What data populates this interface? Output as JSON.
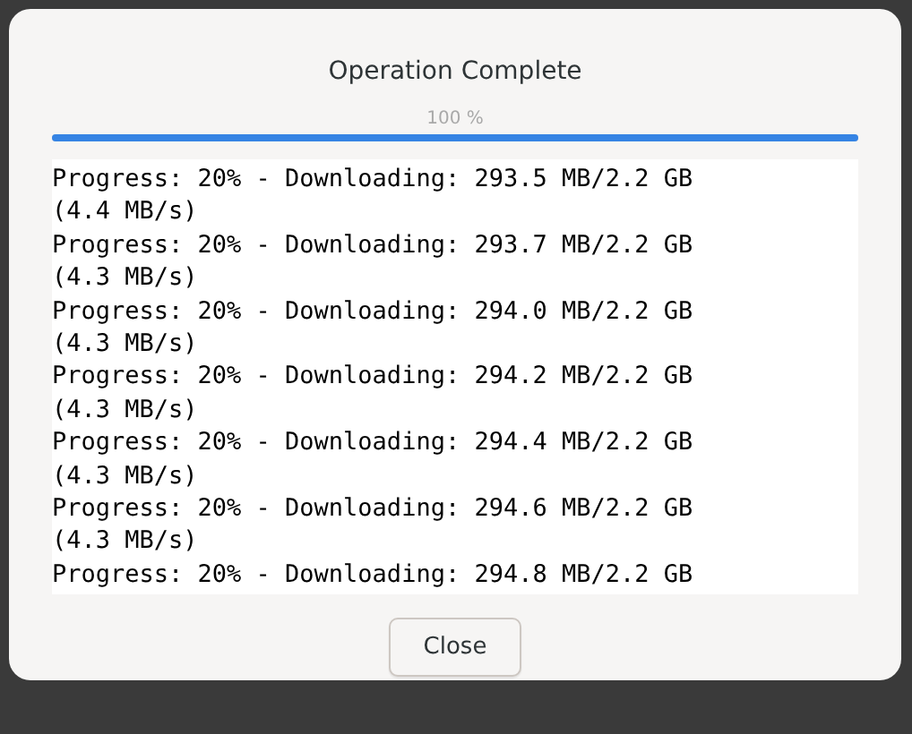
{
  "dialog": {
    "title": "Operation Complete",
    "progress": {
      "label": "100 %",
      "level": 1.0
    },
    "log": {
      "lines": [
        "Progress: 20% - Downloading: 293.5 MB/2.2 GB",
        "(4.4 MB/s)",
        "Progress: 20% - Downloading: 293.7 MB/2.2 GB",
        "(4.3 MB/s)",
        "Progress: 20% - Downloading: 294.0 MB/2.2 GB",
        "(4.3 MB/s)",
        "Progress: 20% - Downloading: 294.2 MB/2.2 GB",
        "(4.3 MB/s)",
        "Progress: 20% - Downloading: 294.4 MB/2.2 GB",
        "(4.3 MB/s)",
        "Progress: 20% - Downloading: 294.6 MB/2.2 GB",
        "(4.3 MB/s)",
        "Progress: 20% - Downloading: 294.8 MB/2.2 GB"
      ]
    },
    "buttons": [
      "Close"
    ]
  }
}
